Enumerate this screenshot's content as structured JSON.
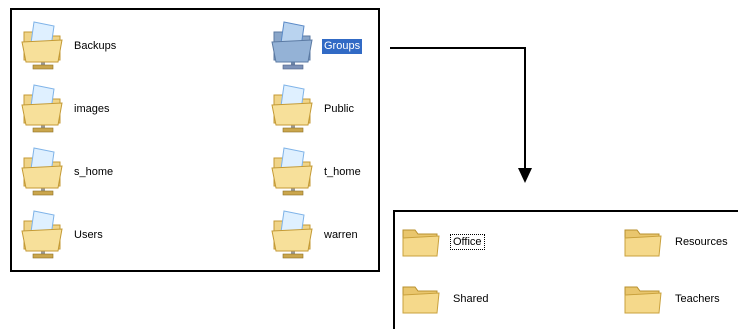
{
  "shares_panel": {
    "items": [
      {
        "label": "Backups",
        "selected": false
      },
      {
        "label": "Groups",
        "selected": true
      },
      {
        "label": "images",
        "selected": false
      },
      {
        "label": "Public",
        "selected": false
      },
      {
        "label": "s_home",
        "selected": false
      },
      {
        "label": "t_home",
        "selected": false
      },
      {
        "label": "Users",
        "selected": false
      },
      {
        "label": "warren",
        "selected": false
      }
    ]
  },
  "groups_panel": {
    "items": [
      {
        "label": "Office",
        "focused": true
      },
      {
        "label": "Resources",
        "focused": false
      },
      {
        "label": "Shared",
        "focused": false
      },
      {
        "label": "Teachers",
        "focused": false
      }
    ]
  },
  "icons": {
    "share": "shared-folder-icon",
    "folder": "folder-icon"
  },
  "colors": {
    "selection": "#316ac5",
    "folder_fill": "#f5d98b",
    "folder_stroke": "#c9a13d",
    "share_blue": "#7fb3e8"
  }
}
